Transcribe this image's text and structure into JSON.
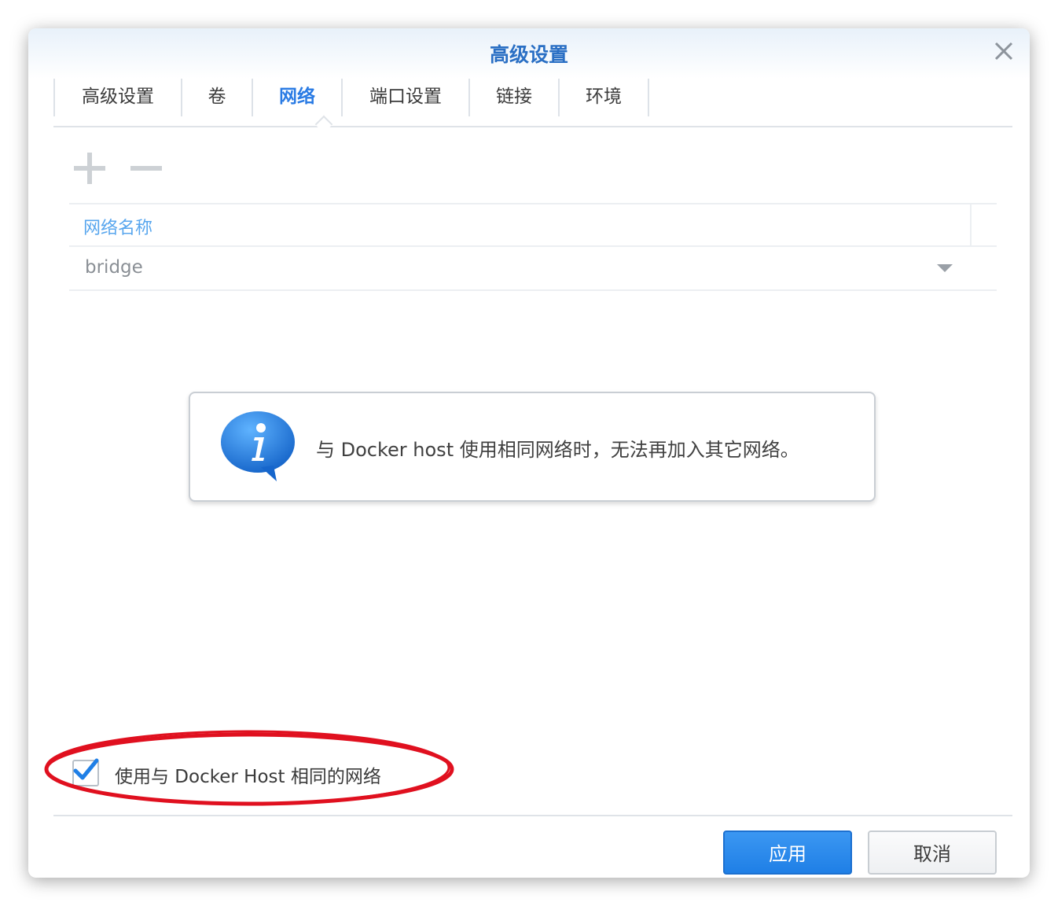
{
  "dialog": {
    "title": "高级设置",
    "close_icon": "close-icon"
  },
  "tabs": [
    {
      "label": "高级设置",
      "active": false
    },
    {
      "label": "卷",
      "active": false
    },
    {
      "label": "网络",
      "active": true
    },
    {
      "label": "端口设置",
      "active": false
    },
    {
      "label": "链接",
      "active": false
    },
    {
      "label": "环境",
      "active": false
    }
  ],
  "toolbar": {
    "add_icon": "plus-icon",
    "remove_icon": "minus-icon"
  },
  "network_grid": {
    "column_header": "网络名称",
    "rows": [
      {
        "name": "bridge",
        "icon": "chevron-down-icon"
      }
    ]
  },
  "info": {
    "icon": "info-icon",
    "message": "与 Docker host 使用相同网络时，无法再加入其它网络。"
  },
  "host_network": {
    "checked": true,
    "label": "使用与 Docker Host 相同的网络"
  },
  "footer": {
    "apply_label": "应用",
    "cancel_label": "取消"
  },
  "colors": {
    "accent": "#2a7be4",
    "primary_button": "#2a86ec",
    "highlight_annotation": "#e0101f"
  }
}
